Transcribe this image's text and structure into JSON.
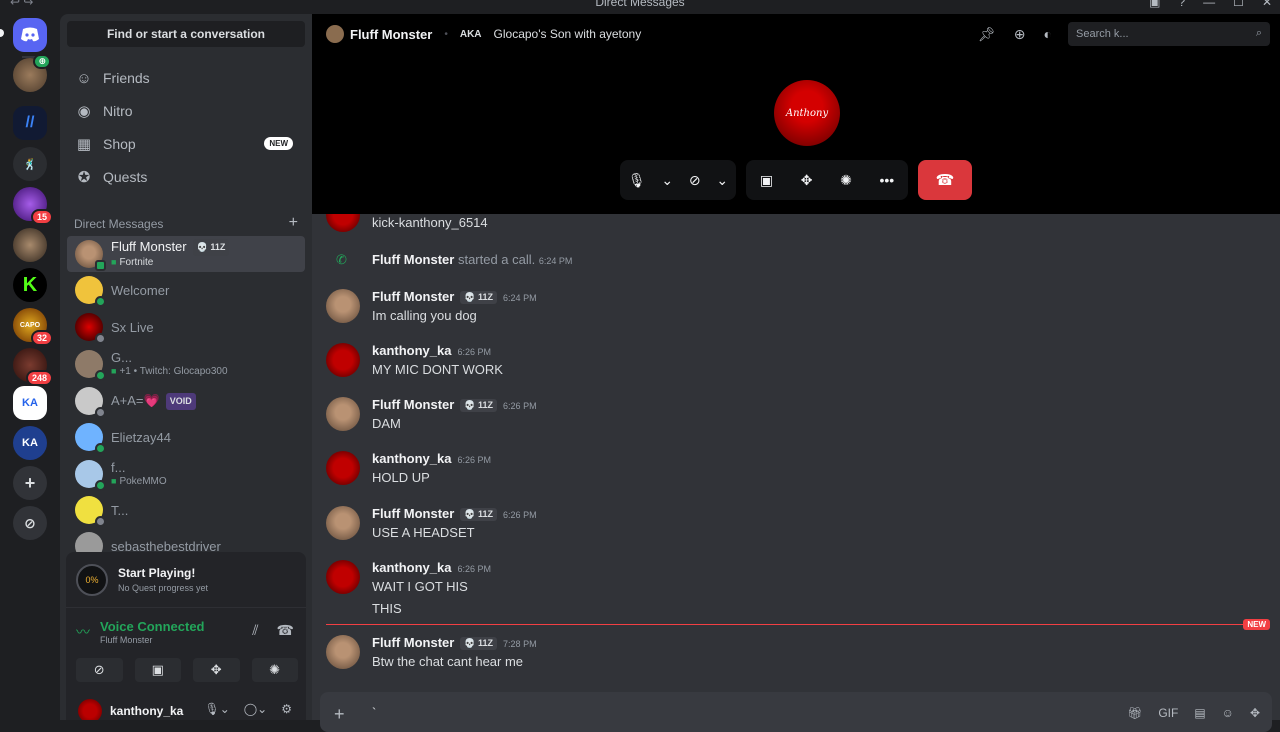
{
  "window": {
    "title": "Direct Messages"
  },
  "guilds": [
    {
      "label": "",
      "badge": ""
    },
    {
      "label": "",
      "badge": ""
    },
    {
      "label": "",
      "badge": ""
    },
    {
      "label": "",
      "badge": ""
    },
    {
      "label": "",
      "badge": "15"
    },
    {
      "label": "",
      "badge": ""
    },
    {
      "label": "",
      "badge": ""
    },
    {
      "label": "",
      "badge": "32"
    },
    {
      "label": "",
      "badge": "248"
    },
    {
      "label": "",
      "badge": ""
    },
    {
      "label": "KA",
      "badge": ""
    }
  ],
  "sidebar": {
    "find_label": "Find or start a conversation",
    "nav": [
      {
        "label": "Friends"
      },
      {
        "label": "Nitro"
      },
      {
        "label": "Shop",
        "badge": "NEW"
      },
      {
        "label": "Quests"
      }
    ],
    "dm_header": "Direct Messages",
    "dms": [
      {
        "name": "Fluff Monster",
        "tag": "💀 11Z",
        "sub": "Fortnite"
      },
      {
        "name": "Welcomer",
        "sub": ""
      },
      {
        "name": "Sx Live",
        "sub": ""
      },
      {
        "name": "G...",
        "sub": "+1 • Twitch: Glocapo300"
      },
      {
        "name": "A+A=💗",
        "tag": "VOID",
        "sub": ""
      },
      {
        "name": "Elietzay44",
        "sub": ""
      },
      {
        "name": "f...",
        "sub": "PokeMMO"
      },
      {
        "name": "T...",
        "sub": ""
      },
      {
        "name": "sebasthebestdriver",
        "sub": ""
      }
    ],
    "quest": {
      "title": "Start Playing!",
      "subtitle": "No Quest progress yet"
    },
    "voice": {
      "status": "Voice Connected",
      "channel": "Fluff Monster"
    },
    "user": {
      "name": "kanthony_ka"
    }
  },
  "call": {
    "name": "Fluff Monster",
    "aka_label": "AKA",
    "alias": "Glocapo's Son with ayetony",
    "search_placeholder": "Search k...",
    "avatar_text": "Anthony"
  },
  "chat": {
    "top_text": "kick-kanthony_6514",
    "system": {
      "name": "Fluff Monster",
      "text": "started a call.",
      "time": "6:24 PM"
    },
    "messages": [
      {
        "author": "Fluff Monster",
        "tag": "💀 11Z",
        "time": "6:24 PM",
        "lines": [
          "Im calling you dog"
        ]
      },
      {
        "author": "kanthony_ka",
        "tag": "",
        "time": "6:26 PM",
        "lines": [
          "MY MIC DONT WORK"
        ]
      },
      {
        "author": "Fluff Monster",
        "tag": "💀 11Z",
        "time": "6:26 PM",
        "lines": [
          "DAM"
        ]
      },
      {
        "author": "kanthony_ka",
        "tag": "",
        "time": "6:26 PM",
        "lines": [
          "HOLD UP"
        ]
      },
      {
        "author": "Fluff Monster",
        "tag": "💀 11Z",
        "time": "6:26 PM",
        "lines": [
          "USE A HEADSET"
        ]
      },
      {
        "author": "kanthony_ka",
        "tag": "",
        "time": "6:26 PM",
        "lines": [
          "WAIT I GOT HIS",
          "THIS"
        ]
      },
      {
        "author": "Fluff Monster",
        "tag": "💀 11Z",
        "time": "7:28 PM",
        "lines": [
          "Btw the chat cant hear me"
        ]
      }
    ],
    "new_label": "NEW"
  },
  "composer": {
    "text": "`"
  }
}
